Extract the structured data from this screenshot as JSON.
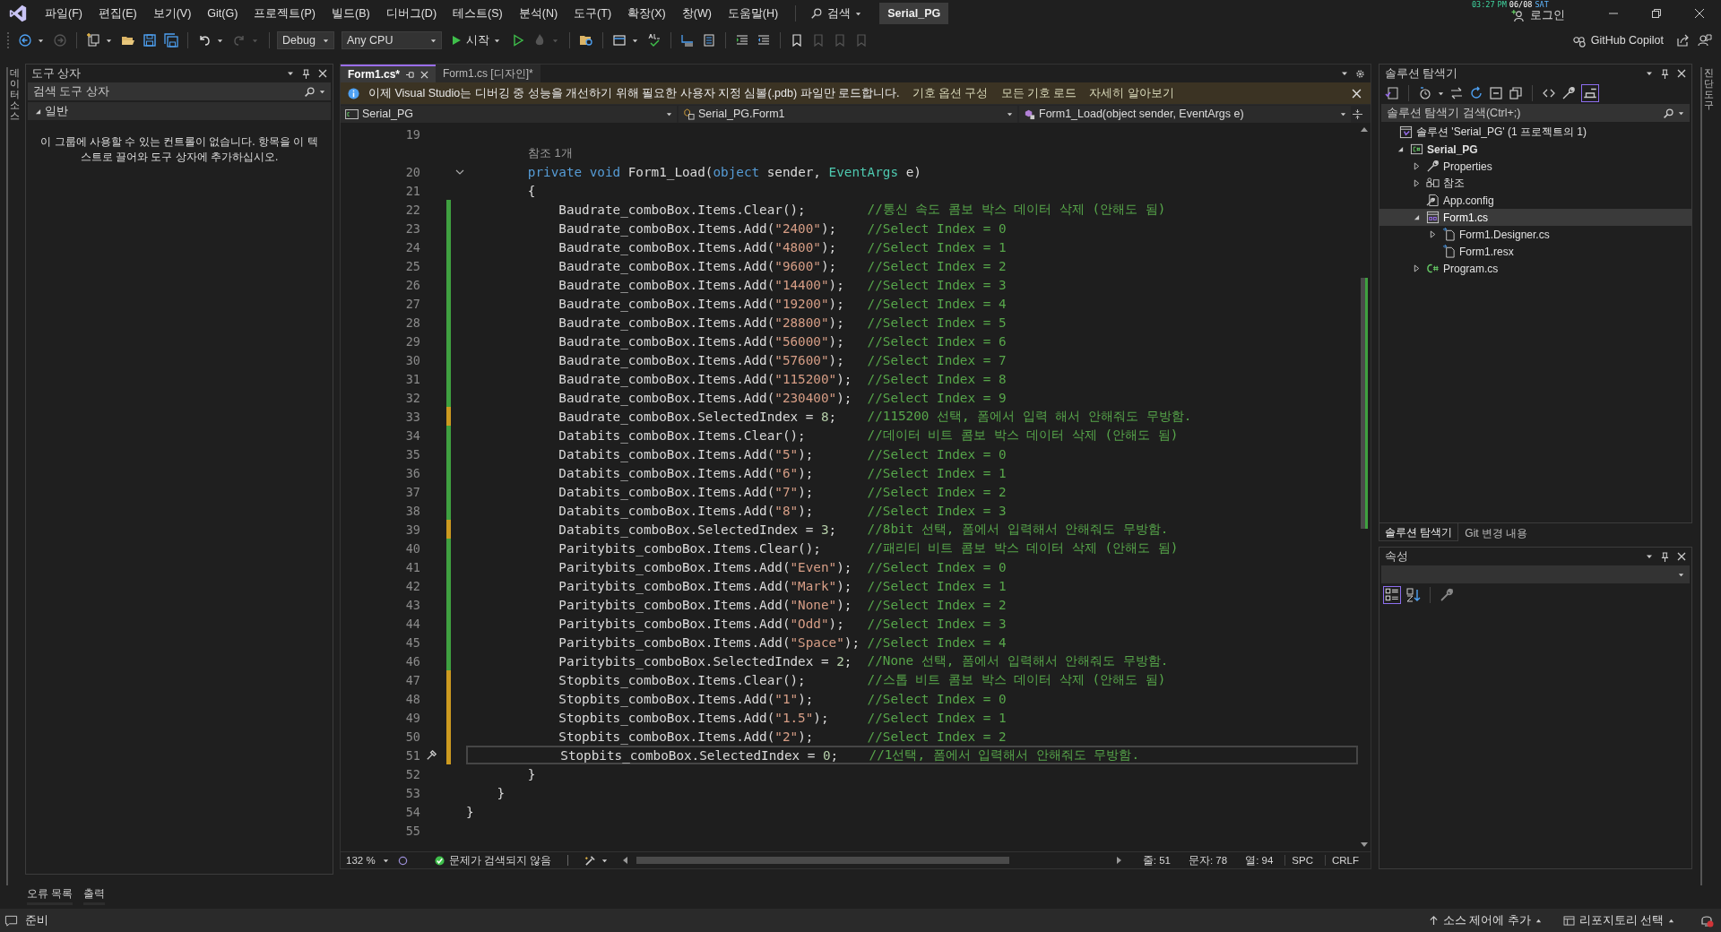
{
  "title_bar": {
    "menu": [
      "파일(F)",
      "편집(E)",
      "보기(V)",
      "Git(G)",
      "프로젝트(P)",
      "빌드(B)",
      "디버그(D)",
      "테스트(S)",
      "분석(N)",
      "도구(T)",
      "확장(X)",
      "창(W)",
      "도움말(H)"
    ],
    "search": "검색",
    "solution_name": "Serial_PG",
    "clock": {
      "time": "03:27",
      "ampm": "PM",
      "date": "06/08",
      "day": "SAT"
    },
    "sign_in": "로그인"
  },
  "toolbar": {
    "configuration": "Debug",
    "platform": "Any CPU",
    "start": "시작",
    "copilot": "GitHub Copilot"
  },
  "left_rail": {
    "label": "데이터 소스"
  },
  "toolbox": {
    "title": "도구 상자",
    "search": {
      "placeholder": "검색 도구 상자"
    },
    "group": {
      "label": "일반",
      "expanded": true
    },
    "empty_message": "이 그룹에 사용할 수 있는 컨트롤이 없습니다. 항목을 이 텍스트로 끌어와 도구 상자에 추가하십시오."
  },
  "editor": {
    "tabs": [
      {
        "label": "Form1.cs*",
        "selected": true
      },
      {
        "label": "Form1.cs [디자인]*",
        "selected": false
      }
    ],
    "info_bar": {
      "message": "이제 Visual Studio는 디버깅 중 성능을 개선하기 위해 필요한 사용자 지정 심볼(.pdb) 파일만 로드합니다.",
      "links": [
        "기호 옵션 구성",
        "모든 기호 로드",
        "자세히 알아보기"
      ]
    },
    "nav": {
      "project": "Serial_PG",
      "type": "Serial_PG.Form1",
      "member": "Form1_Load(object sender, EventArgs e)"
    },
    "lines": [
      {
        "number": "19",
        "kind": "blank",
        "changed": false,
        "current": false
      },
      {
        "kind": "codelens",
        "text": "참조 1개",
        "changed": false,
        "current": false
      },
      {
        "number": "20",
        "kind": "signature",
        "changed": false,
        "current": false,
        "tokens": [
          {
            "text": "private void",
            "kind": "keyword"
          },
          {
            "text": " Form1_Load(",
            "kind": "plain"
          },
          {
            "text": "object",
            "kind": "keyword"
          },
          {
            "text": " sender, ",
            "kind": "plain"
          },
          {
            "text": "EventArgs",
            "kind": "type"
          },
          {
            "text": " e)",
            "kind": "plain"
          }
        ]
      },
      {
        "number": "21",
        "kind": "open",
        "changed": false,
        "current": false,
        "code": "{"
      },
      {
        "number": "22",
        "kind": "statement",
        "changed": true,
        "saved": true,
        "current": false,
        "code": "Baudrate_comboBox.Items.Clear();",
        "comment": "//통신 속도 콤보 박스 데이터 삭제 (안해도 됨)"
      },
      {
        "number": "23",
        "kind": "statement",
        "changed": true,
        "saved": true,
        "current": false,
        "code": "Baudrate_comboBox.Items.Add(\"2400\");",
        "comment": "//Select Index = 0"
      },
      {
        "number": "24",
        "kind": "statement",
        "changed": true,
        "saved": true,
        "current": false,
        "code": "Baudrate_comboBox.Items.Add(\"4800\");",
        "comment": "//Select Index = 1"
      },
      {
        "number": "25",
        "kind": "statement",
        "changed": true,
        "saved": true,
        "current": false,
        "code": "Baudrate_comboBox.Items.Add(\"9600\");",
        "comment": "//Select Index = 2"
      },
      {
        "number": "26",
        "kind": "statement",
        "changed": true,
        "saved": true,
        "current": false,
        "code": "Baudrate_comboBox.Items.Add(\"14400\");",
        "comment": "//Select Index = 3"
      },
      {
        "number": "27",
        "kind": "statement",
        "changed": true,
        "saved": true,
        "current": false,
        "code": "Baudrate_comboBox.Items.Add(\"19200\");",
        "comment": "//Select Index = 4"
      },
      {
        "number": "28",
        "kind": "statement",
        "changed": true,
        "saved": true,
        "current": false,
        "code": "Baudrate_comboBox.Items.Add(\"28800\");",
        "comment": "//Select Index = 5"
      },
      {
        "number": "29",
        "kind": "statement",
        "changed": true,
        "saved": true,
        "current": false,
        "code": "Baudrate_comboBox.Items.Add(\"56000\");",
        "comment": "//Select Index = 6"
      },
      {
        "number": "30",
        "kind": "statement",
        "changed": true,
        "saved": true,
        "current": false,
        "code": "Baudrate_comboBox.Items.Add(\"57600\");",
        "comment": "//Select Index = 7"
      },
      {
        "number": "31",
        "kind": "statement",
        "changed": true,
        "saved": true,
        "current": false,
        "code": "Baudrate_comboBox.Items.Add(\"115200\");",
        "comment": "//Select Index = 8"
      },
      {
        "number": "32",
        "kind": "statement",
        "changed": true,
        "saved": true,
        "current": false,
        "code": "Baudrate_comboBox.Items.Add(\"230400\");",
        "comment": "//Select Index = 9"
      },
      {
        "number": "33",
        "kind": "statement",
        "changed": true,
        "saved": false,
        "current": false,
        "code": "Baudrate_comboBox.SelectedIndex = 8;",
        "comment": "//115200 선택, 폼에서 입력 해서 안해줘도 무방함."
      },
      {
        "number": "34",
        "kind": "statement",
        "changed": true,
        "saved": true,
        "current": false,
        "code": "Databits_comboBox.Items.Clear();",
        "comment": "//데이터 비트 콤보 박스 데이터 삭제 (안해도 됨)"
      },
      {
        "number": "35",
        "kind": "statement",
        "changed": true,
        "saved": true,
        "current": false,
        "code": "Databits_comboBox.Items.Add(\"5\");",
        "comment": "//Select Index = 0"
      },
      {
        "number": "36",
        "kind": "statement",
        "changed": true,
        "saved": true,
        "current": false,
        "code": "Databits_comboBox.Items.Add(\"6\");",
        "comment": "//Select Index = 1"
      },
      {
        "number": "37",
        "kind": "statement",
        "changed": true,
        "saved": true,
        "current": false,
        "code": "Databits_comboBox.Items.Add(\"7\");",
        "comment": "//Select Index = 2"
      },
      {
        "number": "38",
        "kind": "statement",
        "changed": true,
        "saved": true,
        "current": false,
        "code": "Databits_comboBox.Items.Add(\"8\");",
        "comment": "//Select Index = 3"
      },
      {
        "number": "39",
        "kind": "statement",
        "changed": true,
        "saved": false,
        "current": false,
        "code": "Databits_comboBox.SelectedIndex = 3;",
        "comment": "//8bit 선택, 폼에서 입력해서 안해줘도 무방함."
      },
      {
        "number": "40",
        "kind": "statement",
        "changed": true,
        "saved": true,
        "current": false,
        "code": "Paritybits_comboBox.Items.Clear();",
        "comment": "//패리티 비트 콤보 박스 데이터 삭제 (안해도 됨)"
      },
      {
        "number": "41",
        "kind": "statement",
        "changed": true,
        "saved": true,
        "current": false,
        "code": "Paritybits_comboBox.Items.Add(\"Even\");",
        "comment": "//Select Index = 0"
      },
      {
        "number": "42",
        "kind": "statement",
        "changed": true,
        "saved": true,
        "current": false,
        "code": "Paritybits_comboBox.Items.Add(\"Mark\");",
        "comment": "//Select Index = 1"
      },
      {
        "number": "43",
        "kind": "statement",
        "changed": true,
        "saved": true,
        "current": false,
        "code": "Paritybits_comboBox.Items.Add(\"None\");",
        "comment": "//Select Index = 2"
      },
      {
        "number": "44",
        "kind": "statement",
        "changed": true,
        "saved": true,
        "current": false,
        "code": "Paritybits_comboBox.Items.Add(\"Odd\");",
        "comment": "//Select Index = 3"
      },
      {
        "number": "45",
        "kind": "statement",
        "changed": true,
        "saved": true,
        "current": false,
        "code": "Paritybits_comboBox.Items.Add(\"Space\");",
        "comment": "//Select Index = 4"
      },
      {
        "number": "46",
        "kind": "statement",
        "changed": true,
        "saved": true,
        "current": false,
        "code": "Paritybits_comboBox.SelectedIndex = 2;",
        "comment": "//None 선택, 폼에서 입력해서 안해줘도 무방함."
      },
      {
        "number": "47",
        "kind": "statement",
        "changed": true,
        "saved": false,
        "current": false,
        "code": "Stopbits_comboBox.Items.Clear();",
        "comment": "//스톱 비트 콤보 박스 데이터 삭제 (안해도 됨)"
      },
      {
        "number": "48",
        "kind": "statement",
        "changed": true,
        "saved": false,
        "current": false,
        "code": "Stopbits_comboBox.Items.Add(\"1\");",
        "comment": "//Select Index = 0"
      },
      {
        "number": "49",
        "kind": "statement",
        "changed": true,
        "saved": false,
        "current": false,
        "code": "Stopbits_comboBox.Items.Add(\"1.5\");",
        "comment": "//Select Index = 1"
      },
      {
        "number": "50",
        "kind": "statement",
        "changed": true,
        "saved": false,
        "current": false,
        "code": "Stopbits_comboBox.Items.Add(\"2\");",
        "comment": "//Select Index = 2"
      },
      {
        "number": "51",
        "kind": "statement",
        "changed": true,
        "saved": false,
        "current": true,
        "code": "Stopbits_comboBox.SelectedIndex = 0;",
        "comment": "//1선택, 폼에서 입력해서 안해줘도 무방함."
      },
      {
        "number": "52",
        "kind": "close_method",
        "changed": false,
        "current": false,
        "code": "}"
      },
      {
        "number": "53",
        "kind": "close_class",
        "changed": false,
        "current": false,
        "code": "}"
      },
      {
        "number": "54",
        "kind": "close_namespace",
        "changed": false,
        "current": false,
        "code": "}"
      },
      {
        "number": "55",
        "kind": "blank",
        "changed": false,
        "current": false
      }
    ],
    "status": {
      "zoom": "132 %",
      "issues": "문제가 검색되지 않음",
      "line": "줄: 51",
      "char": "문자: 78",
      "col": "열: 94",
      "whitespace": "SPC",
      "line_ending": "CRLF"
    }
  },
  "solution_explorer": {
    "title": "솔루션 탐색기",
    "search": {
      "placeholder": "솔루션 탐색기 검색(Ctrl+;)"
    },
    "tree": [
      {
        "label": "솔루션 'Serial_PG' (1 프로젝트의 1)",
        "kind": "solution",
        "expandable": false,
        "selected": false,
        "children": [
          {
            "label": "Serial_PG",
            "kind": "project",
            "expandable": true,
            "expanded": true,
            "selected": false,
            "children": [
              {
                "label": "Properties",
                "kind": "properties",
                "expandable": true,
                "expanded": false,
                "selected": false
              },
              {
                "label": "참조",
                "kind": "references",
                "expandable": true,
                "expanded": false,
                "selected": false
              },
              {
                "label": "App.config",
                "kind": "config",
                "expandable": false,
                "selected": false
              },
              {
                "label": "Form1.cs",
                "kind": "form",
                "expandable": true,
                "expanded": true,
                "selected": true,
                "children": [
                  {
                    "label": "Form1.Designer.cs",
                    "kind": "file",
                    "expandable": true,
                    "expanded": false,
                    "selected": false
                  },
                  {
                    "label": "Form1.resx",
                    "kind": "file",
                    "expandable": false,
                    "selected": false
                  }
                ]
              },
              {
                "label": "Program.cs",
                "kind": "csharp",
                "expandable": true,
                "expanded": false,
                "selected": false
              }
            ]
          }
        ]
      }
    ]
  },
  "panel_tabs": [
    {
      "label": "솔루션 탐색기",
      "selected": true
    },
    {
      "label": "Git 변경 내용",
      "selected": false
    }
  ],
  "properties": {
    "title": "속성"
  },
  "right_rail": {
    "label": "진단 도구"
  },
  "bottom_tabs": [
    "오류 목록",
    "출력"
  ],
  "status_bar": {
    "state": "준비",
    "source_control": "소스 제어에 추가",
    "repository": "리포지토리 선택"
  }
}
